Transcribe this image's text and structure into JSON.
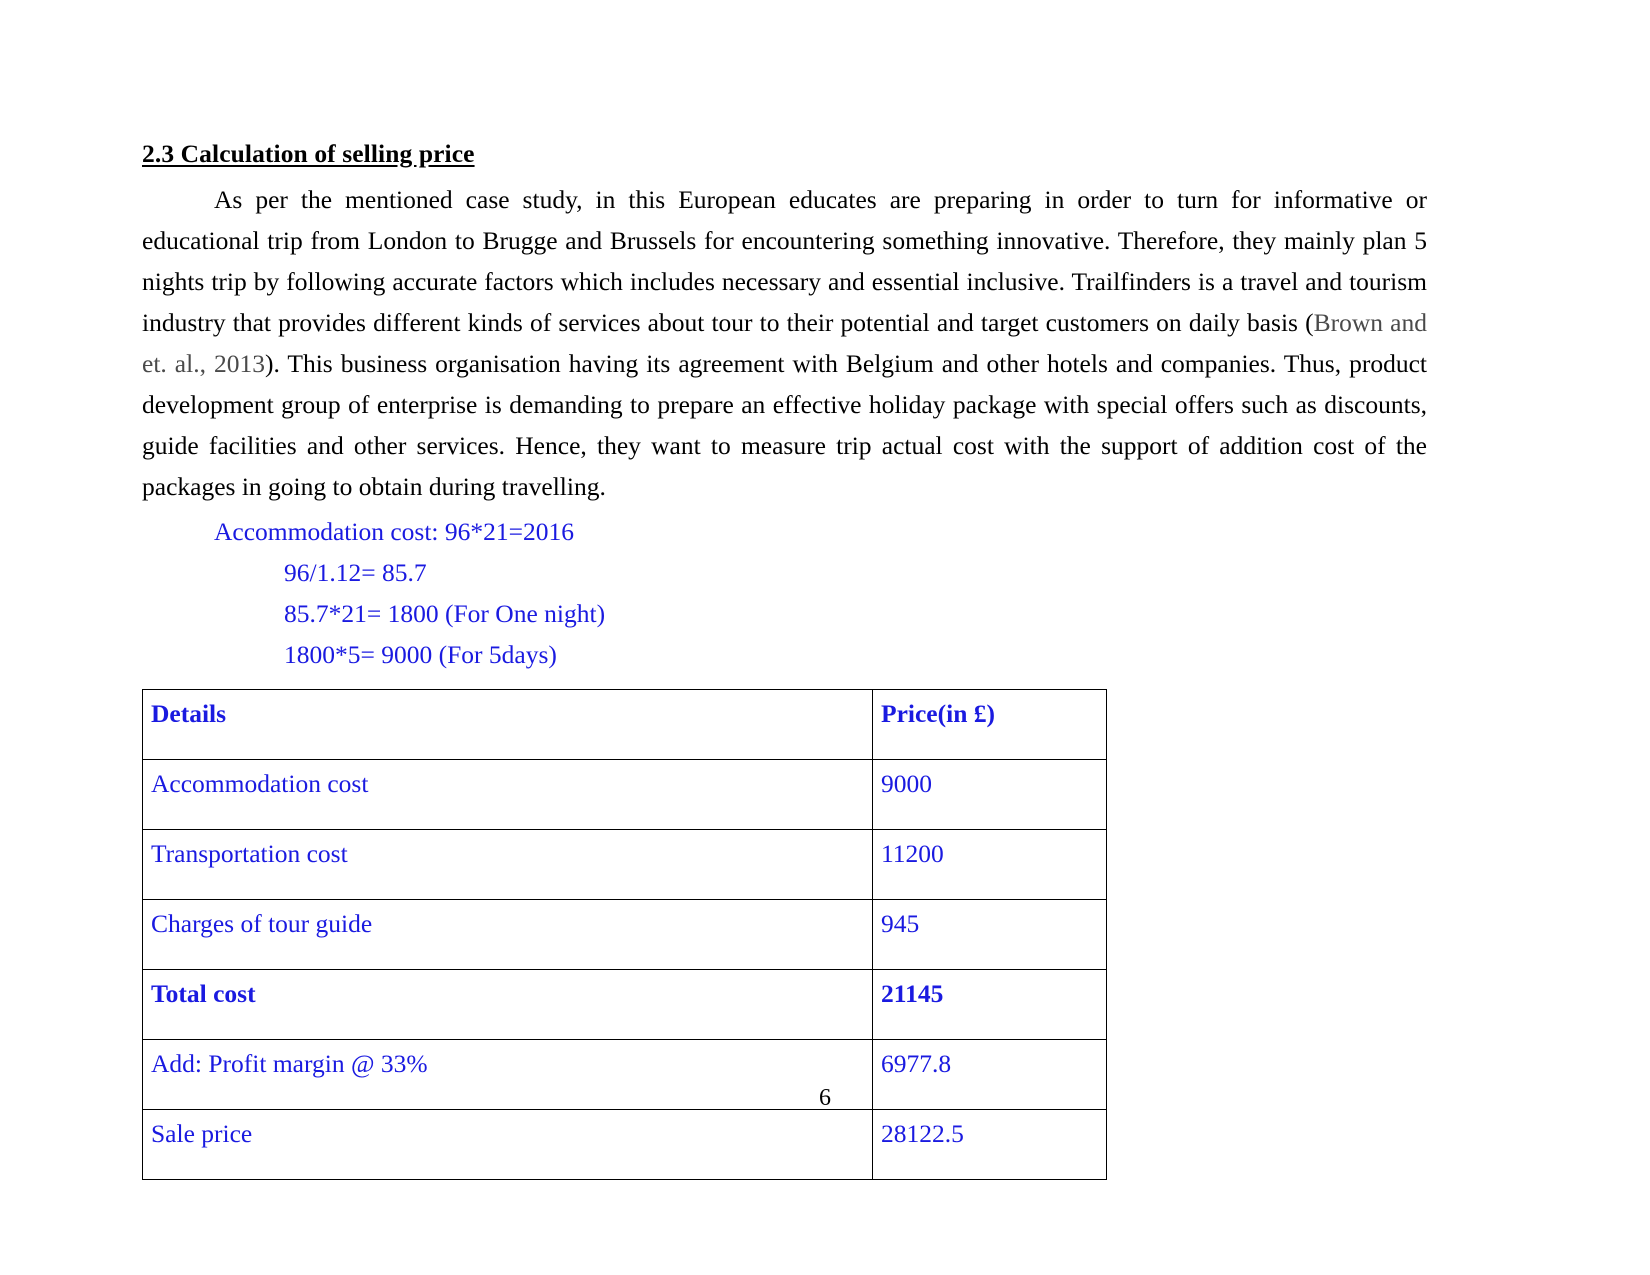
{
  "document": {
    "heading": "2.3 Calculation of selling price",
    "paragraph": {
      "part1": "As per the mentioned case study, in this European educates are preparing in order to turn for informative or educational trip from London to Brugge and Brussels for encountering something innovative. Therefore, they mainly plan 5 nights trip by following accurate factors which includes necessary and essential inclusive. Trailfinders is a travel and tourism industry that provides different kinds of services about tour to their potential and target customers on daily basis (",
      "citation": "Brown and et. al., 2013",
      "part2": "). This business organisation having its agreement with Belgium and other hotels and companies. Thus, product development group of enterprise is demanding to prepare an effective holiday package with special offers such as discounts, guide facilities and other services. Hence, they want to measure trip actual cost with the support of addition cost of the packages in going to obtain during travelling."
    },
    "calculations": [
      {
        "text": "Accommodation cost: 96*21=2016",
        "indent": "lvl1"
      },
      {
        "text": "96/1.12= 85.7",
        "indent": "lvl2"
      },
      {
        "text": "85.7*21= 1800 (For One night)",
        "indent": "lvl2"
      },
      {
        "text": "1800*5= 9000 (For 5days)",
        "indent": "lvl2"
      }
    ],
    "table": {
      "headers": [
        "Details",
        "Price(in £)"
      ],
      "rows": [
        {
          "details": "Accommodation cost",
          "price": "9000",
          "bold": false
        },
        {
          "details": "Transportation cost",
          "price": "11200",
          "bold": false
        },
        {
          "details": "Charges of tour guide",
          "price": "945",
          "bold": false
        },
        {
          "details": "Total cost",
          "price": "21145",
          "bold": true
        },
        {
          "details": "Add: Profit margin @ 33%",
          "price": "6977.8",
          "bold": false
        },
        {
          "details": "Sale price",
          "price": "28122.5",
          "bold": false
        }
      ]
    },
    "page_number": "6",
    "colors": {
      "text": "#000000",
      "accent_blue": "#1a1ae0",
      "citation_grey": "#4a4a4a",
      "border": "#000000"
    }
  }
}
